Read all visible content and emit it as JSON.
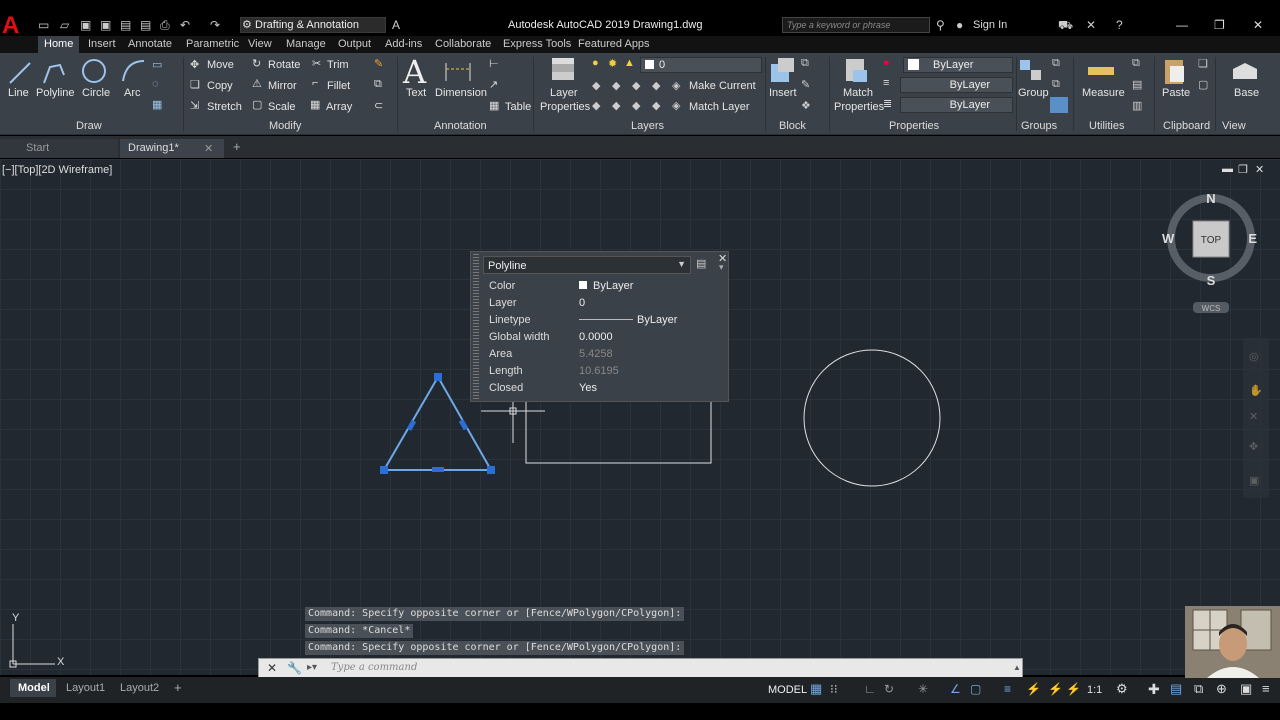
{
  "titlebar": {
    "workspace": "Drafting & Annotation",
    "title": "Autodesk AutoCAD 2019   Drawing1.dwg",
    "search_placeholder": "Type a keyword or phrase",
    "signin": "Sign In"
  },
  "ribbon_tabs": [
    "Home",
    "Insert",
    "Annotate",
    "Parametric",
    "View",
    "Manage",
    "Output",
    "Add-ins",
    "Collaborate",
    "Express Tools",
    "Featured Apps"
  ],
  "draw": {
    "line": "Line",
    "polyline": "Polyline",
    "circle": "Circle",
    "arc": "Arc",
    "panel": "Draw"
  },
  "modify": {
    "move": "Move",
    "rotate": "Rotate",
    "trim": "Trim",
    "copy": "Copy",
    "mirror": "Mirror",
    "fillet": "Fillet",
    "stretch": "Stretch",
    "scale": "Scale",
    "array": "Array",
    "panel": "Modify"
  },
  "annotation": {
    "text": "Text",
    "dimension": "Dimension",
    "table": "Table",
    "panel": "Annotation"
  },
  "layers": {
    "layer_properties_1": "Layer",
    "layer_properties_2": "Properties",
    "current_layer": "0",
    "make_current": "Make Current",
    "match_layer": "Match Layer",
    "panel": "Layers"
  },
  "block": {
    "insert": "Insert",
    "panel": "Block"
  },
  "properties": {
    "match_1": "Match",
    "match_2": "Properties",
    "color": "ByLayer",
    "linetype": "ByLayer",
    "lineweight": "ByLayer",
    "panel": "Properties"
  },
  "groups": {
    "group": "Group",
    "panel": "Groups"
  },
  "utilities": {
    "measure": "Measure",
    "panel": "Utilities"
  },
  "clipboard": {
    "paste": "Paste",
    "panel": "Clipboard"
  },
  "view_panel": {
    "base": "Base",
    "panel": "View"
  },
  "filetabs": {
    "start": "Start",
    "drawing": "Drawing1*"
  },
  "viewport_label": "[−][Top][2D Wireframe]",
  "viewcube": {
    "n": "N",
    "s": "S",
    "e": "E",
    "w": "W",
    "top": "TOP",
    "wcs": "WCS"
  },
  "quick_properties": {
    "type": "Polyline",
    "rows": [
      {
        "key": "Color",
        "value": "ByLayer"
      },
      {
        "key": "Layer",
        "value": "0"
      },
      {
        "key": "Linetype",
        "value": "ByLayer"
      },
      {
        "key": "Global width",
        "value": "0.0000"
      },
      {
        "key": "Area",
        "value": "5.4258"
      },
      {
        "key": "Length",
        "value": "10.6195"
      },
      {
        "key": "Closed",
        "value": "Yes"
      }
    ]
  },
  "command_history": [
    "Command: Specify opposite corner or [Fence/WPolygon/CPolygon]:",
    "Command: *Cancel*",
    "Command: Specify opposite corner or [Fence/WPolygon/CPolygon]:"
  ],
  "command_placeholder": "Type a command",
  "layout_tabs": [
    "Model",
    "Layout1",
    "Layout2"
  ],
  "status": {
    "model": "MODEL",
    "scale": "1:1"
  },
  "ucs": {
    "x": "X",
    "y": "Y"
  }
}
